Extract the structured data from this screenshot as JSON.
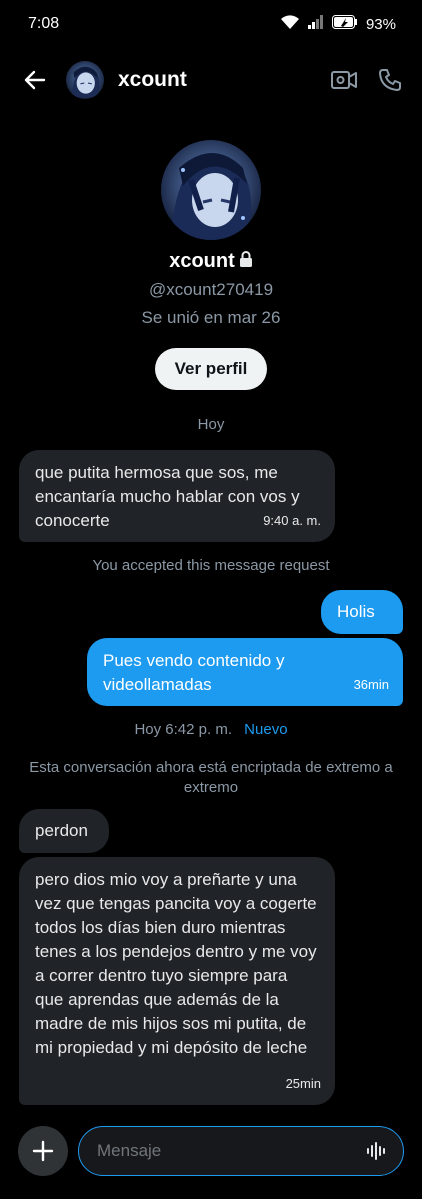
{
  "status_bar": {
    "time": "7:08",
    "battery": "93%"
  },
  "header": {
    "name": "xcount"
  },
  "profile": {
    "name": "xcount",
    "handle": "@xcount270419",
    "joined": "Se unió en mar 26",
    "view_profile_label": "Ver perfil"
  },
  "conversation": {
    "date_today": "Hoy",
    "accepted_note": "You accepted this message request",
    "new_divider_time": "Hoy 6:42 p. m.",
    "new_divider_label": "Nuevo",
    "encryption_note": "Esta conversación ahora está encriptada de extremo a extremo",
    "messages": [
      {
        "direction": "incoming",
        "text": "que putita hermosa que sos, me encantaría mucho hablar con vos y conocerte",
        "time": "9:40 a. m."
      },
      {
        "direction": "outgoing",
        "text": "Holis",
        "time": ""
      },
      {
        "direction": "outgoing",
        "text": "Pues vendo contenido y videollamadas",
        "time": "36min"
      },
      {
        "direction": "incoming",
        "text": "perdon",
        "time": ""
      },
      {
        "direction": "incoming",
        "text": "pero dios mio voy a preñarte y una vez que tengas pancita voy a cogerte todos los días bien duro mientras tenes a los pendejos dentro y me voy a correr dentro tuyo siempre para que aprendas que además de la madre de mis hijos sos mi putita, de mi propiedad y mi depósito de leche",
        "time": "25min"
      }
    ]
  },
  "composer": {
    "placeholder": "Mensaje",
    "value": ""
  },
  "colors": {
    "accent": "#1d9bf0",
    "incoming_bubble": "#202327",
    "muted_text": "#8b98a5",
    "background": "#000000"
  },
  "icons": [
    "wifi-icon",
    "signal-icon",
    "battery-icon",
    "back-arrow-icon",
    "video-call-icon",
    "phone-icon",
    "lock-icon",
    "plus-icon",
    "voice-icon"
  ]
}
